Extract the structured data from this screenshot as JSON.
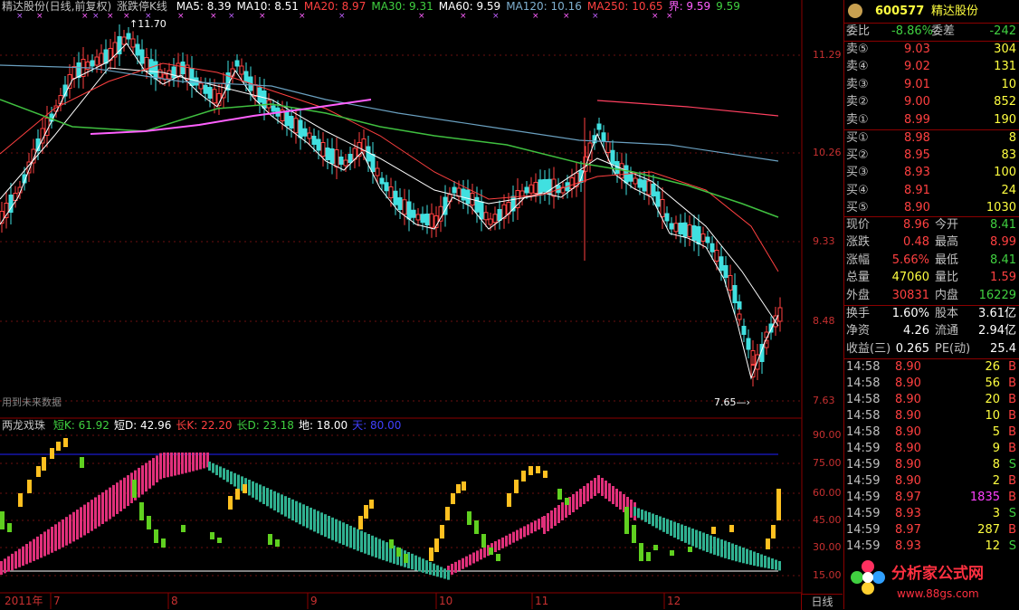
{
  "header": {
    "title": "精达股份(日线,前复权)",
    "indicator": "涨跌停K线",
    "ma": [
      {
        "label": "MA5: 8.39",
        "color": "#ffffff"
      },
      {
        "label": "MA10: 8.51",
        "color": "#ffffff"
      },
      {
        "label": "MA20: 8.97",
        "color": "#ff4040"
      },
      {
        "label": "MA30: 9.31",
        "color": "#40d040"
      },
      {
        "label": "MA60: 9.59",
        "color": "#ffffff"
      },
      {
        "label": "MA120: 10.16",
        "color": "#7fb0d0"
      },
      {
        "label": "MA250: 10.65",
        "color": "#ff4040"
      },
      {
        "label": "界: 9.59",
        "color": "#ff60ff"
      },
      {
        "label": "9.59",
        "color": "#40d040"
      }
    ]
  },
  "price_axis": [
    "11.29",
    "10.26",
    "9.33",
    "8.48",
    "7.63"
  ],
  "osc_axis": [
    "90.00",
    "75.00",
    "60.00",
    "45.00",
    "30.00",
    "15.00"
  ],
  "annotations": {
    "high_label": "11.70",
    "low_label": "7.65",
    "watermark": "用到未来数据"
  },
  "oscillator": {
    "name": "两龙戏珠",
    "values": [
      {
        "label": "短K: 61.92",
        "color": "#40d040"
      },
      {
        "label": "短D: 42.96",
        "color": "#ffffff"
      },
      {
        "label": "长K: 22.20",
        "color": "#ff4040"
      },
      {
        "label": "长D: 23.18",
        "color": "#40d040"
      },
      {
        "label": "地: 18.00",
        "color": "#ffffff"
      },
      {
        "label": "天: 80.00",
        "color": "#4040ff"
      }
    ]
  },
  "time_axis": {
    "labels": [
      "2011年",
      "7",
      "8",
      "9",
      "10",
      "11",
      "12"
    ],
    "period_tab": "日线"
  },
  "quote": {
    "code": "600577",
    "name": "精达股份",
    "weibi": {
      "label": "委比",
      "value": "-8.86%",
      "label2": "委差",
      "value2": "-242"
    },
    "sell": [
      {
        "label": "卖⑤",
        "price": "9.03",
        "vol": "304"
      },
      {
        "label": "卖④",
        "price": "9.02",
        "vol": "131"
      },
      {
        "label": "卖③",
        "price": "9.01",
        "vol": "10"
      },
      {
        "label": "卖②",
        "price": "9.00",
        "vol": "852"
      },
      {
        "label": "卖①",
        "price": "8.99",
        "vol": "190"
      }
    ],
    "buy": [
      {
        "label": "买①",
        "price": "8.98",
        "vol": "8"
      },
      {
        "label": "买②",
        "price": "8.95",
        "vol": "83"
      },
      {
        "label": "买③",
        "price": "8.93",
        "vol": "100"
      },
      {
        "label": "买④",
        "price": "8.91",
        "vol": "24"
      },
      {
        "label": "买⑤",
        "price": "8.90",
        "vol": "1030"
      }
    ],
    "stats1": [
      {
        "l1": "现价",
        "v1": "8.96",
        "c1": "#ff4040",
        "l2": "今开",
        "v2": "8.41",
        "c2": "#40d040"
      },
      {
        "l1": "涨跌",
        "v1": "0.48",
        "c1": "#ff4040",
        "l2": "最高",
        "v2": "8.99",
        "c2": "#ff4040"
      },
      {
        "l1": "涨幅",
        "v1": "5.66%",
        "c1": "#ff4040",
        "l2": "最低",
        "v2": "8.41",
        "c2": "#40d040"
      },
      {
        "l1": "总量",
        "v1": "47060",
        "c1": "#ffff40",
        "l2": "量比",
        "v2": "1.59",
        "c2": "#ff4040"
      },
      {
        "l1": "外盘",
        "v1": "30831",
        "c1": "#ff4040",
        "l2": "内盘",
        "v2": "16229",
        "c2": "#40d040"
      }
    ],
    "stats2": [
      {
        "l1": "换手",
        "v1": "1.60%",
        "l2": "股本",
        "v2": "3.61亿"
      },
      {
        "l1": "净资",
        "v1": "4.26",
        "l2": "流通",
        "v2": "2.94亿"
      },
      {
        "l1": "收益(三)",
        "v1": "0.265",
        "l2": "PE(动)",
        "v2": "25.4"
      }
    ],
    "ticks": [
      {
        "time": "14:58",
        "price": "8.90",
        "vol": "26",
        "side": "B"
      },
      {
        "time": "14:58",
        "price": "8.90",
        "vol": "56",
        "side": "B"
      },
      {
        "time": "14:58",
        "price": "8.90",
        "vol": "20",
        "side": "B"
      },
      {
        "time": "14:58",
        "price": "8.90",
        "vol": "10",
        "side": "B"
      },
      {
        "time": "14:58",
        "price": "8.90",
        "vol": "5",
        "side": "B"
      },
      {
        "time": "14:59",
        "price": "8.90",
        "vol": "9",
        "side": "B"
      },
      {
        "time": "14:59",
        "price": "8.90",
        "vol": "8",
        "side": "S"
      },
      {
        "time": "14:59",
        "price": "8.90",
        "vol": "2",
        "side": "B"
      },
      {
        "time": "14:59",
        "price": "8.97",
        "vol": "1835",
        "side": "B"
      },
      {
        "time": "14:59",
        "price": "8.93",
        "vol": "3",
        "side": "S"
      },
      {
        "time": "14:59",
        "price": "8.97",
        "vol": "287",
        "side": "B"
      },
      {
        "time": "14:59",
        "price": "8.93",
        "vol": "12",
        "side": "S"
      }
    ]
  },
  "logo": {
    "text": "分析家公式网",
    "url": "www.88gs.com"
  }
}
